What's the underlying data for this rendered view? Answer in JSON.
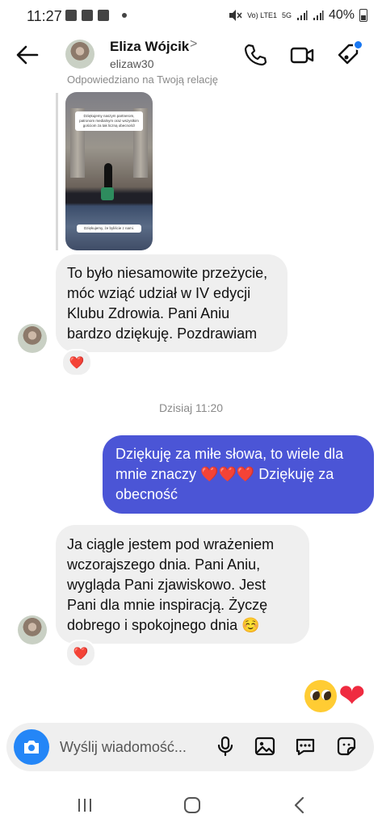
{
  "status_bar": {
    "time": "11:27",
    "battery": "40%",
    "network": "5G",
    "carrier_tag": "Vo) LTE1"
  },
  "header": {
    "name": "Eliza Wójcik",
    "username": "elizaw30",
    "chevron": ">"
  },
  "story_reply": {
    "label": "Odpowiedziano na Twoją relację",
    "caption_top": "Dziękujemy naszym partnerom, patronom medialnym oraz wszystkim gościom za tak liczną obecność!",
    "caption_bottom": "Dziękujemy, że byliście z nami."
  },
  "messages": [
    {
      "id": "m1",
      "direction": "incoming",
      "text": "To było niesamowite przeżycie, móc wziąć udział w IV edycji Klubu Zdrowia. Pani Aniu bardzo dziękuję. Pozdrawiam",
      "reaction": "❤️"
    },
    {
      "id": "divider",
      "timestamp": "Dzisiaj 11:20"
    },
    {
      "id": "m2",
      "direction": "outgoing",
      "text": "Dziękuję za miłe słowa, to wiele dla mnie znaczy ❤️❤️❤️ Dziękuję za obecność"
    },
    {
      "id": "m3",
      "direction": "incoming",
      "text": "Ja ciągle jestem pod wrażeniem wczorajszego dnia. Pani Aniu, wygląda Pani zjawiskowo. Jest Pani dla mnie inspiracją. Życzę dobrego i spokojnego dnia ☺️",
      "reaction": "❤️"
    },
    {
      "id": "m4",
      "direction": "outgoing",
      "emoji": "🥺❤️"
    }
  ],
  "composer": {
    "placeholder": "Wyślij wiadomość..."
  },
  "icons": {
    "back": "arrow-left-icon",
    "call": "phone-icon",
    "video": "video-camera-icon",
    "tag": "tag-icon",
    "camera": "camera-icon",
    "mic": "microphone-icon",
    "gallery": "image-icon",
    "chat": "chat-bubble-icon",
    "sticker": "sticker-icon"
  },
  "colors": {
    "outgoing_bubble": "#4b55d6",
    "incoming_bubble": "#efefef",
    "camera_button": "#2486f7",
    "heart": "#ef2b59",
    "badge": "#1877f2"
  }
}
